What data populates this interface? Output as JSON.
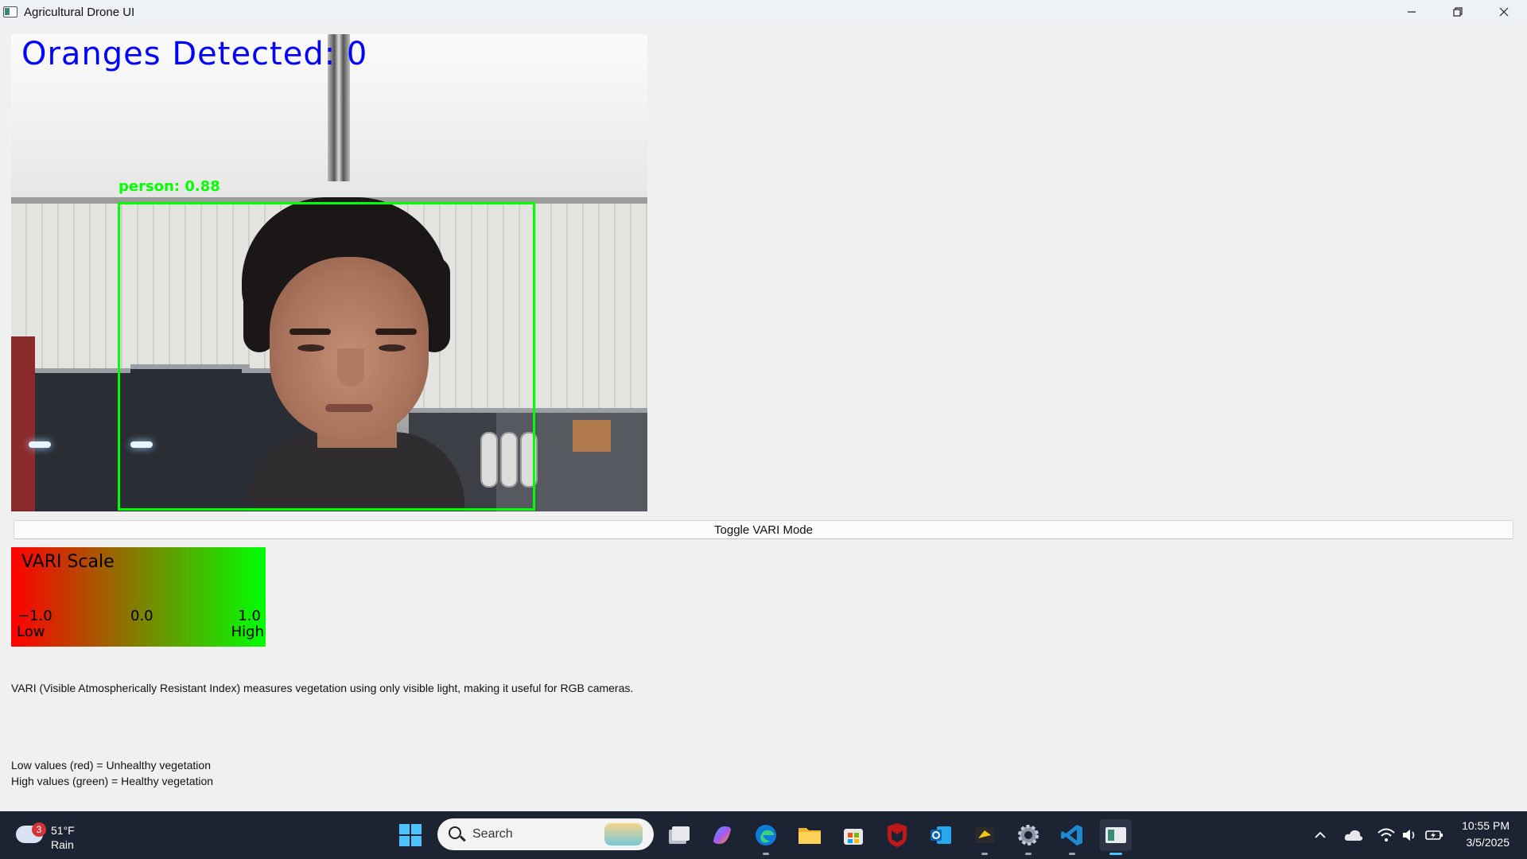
{
  "window": {
    "title": "Agricultural Drone UI",
    "controls": {
      "minimize": "—",
      "restore": "❐",
      "close": "✕"
    }
  },
  "video": {
    "overlay_text": "Oranges Detected: 0",
    "detection": {
      "label": "person: 0.88",
      "color": "#00ff00"
    },
    "overlay_color": "#0000ff"
  },
  "toggle_button": {
    "label": "Toggle VARI Mode"
  },
  "vari_scale": {
    "title": "VARI Scale",
    "min_value": "−1.0",
    "mid_value": "0.0",
    "max_value": "1.0",
    "low_label": "Low",
    "high_label": "High",
    "colors": {
      "low": "#ff0000",
      "mid": "#808000",
      "high": "#00ff00"
    }
  },
  "description": "VARI (Visible Atmospherically Resistant Index) measures vegetation using only visible light, making it useful for RGB cameras.",
  "legend": {
    "low": "Low values (red) = Unhealthy vegetation",
    "high": "High values (green) = Healthy vegetation"
  },
  "taskbar": {
    "weather": {
      "temperature": "51°F",
      "condition": "Rain",
      "badge": "3"
    },
    "search_placeholder": "Search",
    "apps": [
      "task-view",
      "copilot",
      "edge",
      "file-explorer",
      "microsoft-store",
      "mcafee",
      "outlook",
      "app-bird",
      "settings",
      "vscode",
      "agricultural-drone-ui"
    ],
    "tray": {
      "chevron": "˄"
    },
    "clock": {
      "time": "10:55 PM",
      "date": "3/5/2025"
    },
    "accent_color": "#4cc2ff"
  }
}
